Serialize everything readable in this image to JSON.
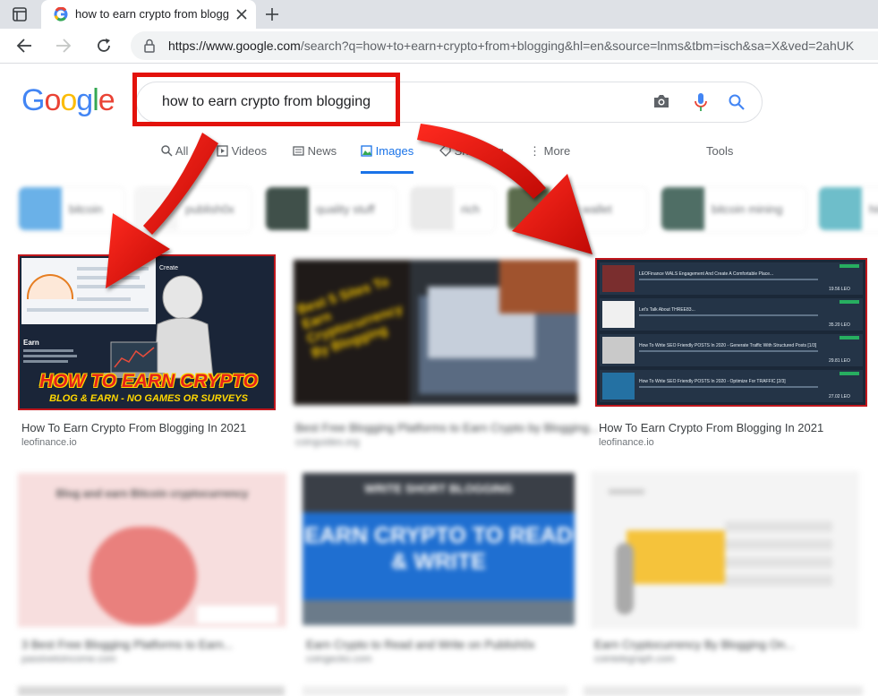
{
  "browser": {
    "tab_title": "how to earn crypto from bloggin",
    "url_host": "https://www.google.com",
    "url_path": "/search?q=how+to+earn+crypto+from+blogging&hl=en&source=lnms&tbm=isch&sa=X&ved=2ahUK"
  },
  "google": {
    "logo_letters": [
      "G",
      "o",
      "o",
      "g",
      "l",
      "e"
    ],
    "logo_colors": [
      "#4285f4",
      "#ea4335",
      "#fbbc05",
      "#4285f4",
      "#34a853",
      "#ea4335"
    ],
    "query": "how to earn crypto from blogging",
    "tabs": [
      "All",
      "Videos",
      "News",
      "Images",
      "Shopping",
      "More"
    ],
    "tools": "Tools",
    "active_tab": "Images",
    "chips": [
      "bitcoin",
      "publish0x",
      "quality stuff",
      "rich",
      "hive wallet",
      "bitcoin mining",
      "hive"
    ]
  },
  "results": [
    {
      "title": "How To Earn Crypto From Blogging In 2021",
      "domain": "leofinance.io",
      "overlay": "HOW TO EARN CRYPTO",
      "overlay_sub": "BLOG & EARN - NO GAMES OR SURVEYS",
      "panel_title": "Create",
      "panel_heading": "Earn"
    },
    {
      "title": "Best Free Blogging Platforms to Earn Crypto by Blogging...",
      "domain": "coinguides.org",
      "overlay": "Best 5 Sites To Earn Cryptocurrency By Blogging"
    },
    {
      "title": "How To Earn Crypto From Blogging In 2021",
      "domain": "leofinance.io",
      "overlay": "",
      "posts": [
        {
          "title": "LEOFinance WALS Engagement And Create A Comfortable Place...",
          "value": "19.56 LEO"
        },
        {
          "title": "Let's Talk About THREE83...",
          "value": "35.20 LEO"
        },
        {
          "title": "How To Write SEO Friendly POSTS In 2020 - Generate Traffic With Structured Posts [1/3]",
          "value": "29.81 LEO"
        },
        {
          "title": "How To Write SEO Friendly POSTS In 2020 - Optimize For TRAFFIC [2/3]",
          "value": "27.02 LEO"
        }
      ]
    },
    {
      "title": "3 Best Free Blogging Platforms to Earn...",
      "domain": "passivetoincome.com",
      "overlay": "Blog and earn Bitcoin cryptocurrency"
    },
    {
      "title": "Earn Crypto to Read and Write on Publish0x",
      "domain": "coingecko.com",
      "overlay": "EARN CRYPTO TO READ & WRITE",
      "overlay_top": "WRITE SHORT BLOGGING"
    },
    {
      "title": "Earn Cryptocurrency By Blogging On...",
      "domain": "cointelegraph.com",
      "overlay": ""
    }
  ],
  "colors": {
    "annotation_red": "#e3120b",
    "google_blue": "#1a73e8"
  },
  "icons": [
    "window-icon",
    "google-favicon",
    "close-icon",
    "new-tab-icon",
    "back-icon",
    "forward-icon",
    "reload-icon",
    "lock-icon",
    "camera-icon",
    "mic-icon",
    "search-icon"
  ]
}
